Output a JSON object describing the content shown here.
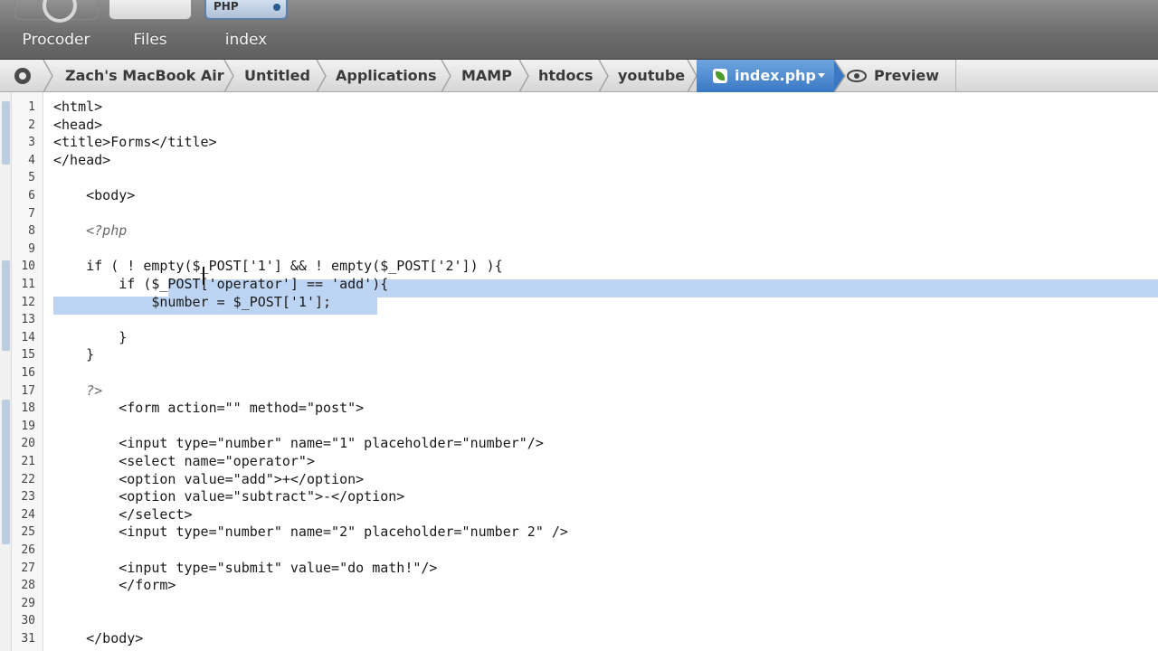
{
  "toolbar": {
    "tools": [
      {
        "label": "Procoder"
      },
      {
        "label": "Files"
      },
      {
        "label": "index",
        "badge": "PHP"
      }
    ]
  },
  "breadcrumb": {
    "items": [
      "Zach's MacBook Air",
      "Untitled",
      "Applications",
      "MAMP",
      "htdocs",
      "youtube"
    ],
    "active": "index.php",
    "preview": "Preview"
  },
  "editor": {
    "colors": {
      "tag": "#1a1a1a",
      "string": "#1a1a1a",
      "comment": "#6b6b6b",
      "selection": "#bdd4f2",
      "keyword_op": "#2f6fd0"
    },
    "lines": [
      {
        "n": "1",
        "text": "<html>"
      },
      {
        "n": "2",
        "text": "<head>"
      },
      {
        "n": "3",
        "text": "<title>Forms</title>"
      },
      {
        "n": "4",
        "text": "</head>"
      },
      {
        "n": "5",
        "text": ""
      },
      {
        "n": "6",
        "text": "    <body>"
      },
      {
        "n": "7",
        "text": ""
      },
      {
        "n": "8",
        "text": "    <?php"
      },
      {
        "n": "9",
        "text": ""
      },
      {
        "n": "10",
        "text": "    if ( ! empty($_POST['1'] && ! empty($_POST['2']) ){"
      },
      {
        "n": "11",
        "text": "        if ($_POST['operator'] == 'add'){"
      },
      {
        "n": "12",
        "text": "            $number = $_POST['1'];"
      },
      {
        "n": "13",
        "text": ""
      },
      {
        "n": "14",
        "text": "        }"
      },
      {
        "n": "15",
        "text": "    }"
      },
      {
        "n": "16",
        "text": ""
      },
      {
        "n": "17",
        "text": "    ?>"
      },
      {
        "n": "18",
        "text": "        <form action=\"\" method=\"post\">"
      },
      {
        "n": "19",
        "text": ""
      },
      {
        "n": "20",
        "text": "        <input type=\"number\" name=\"1\" placeholder=\"number\"/>"
      },
      {
        "n": "21",
        "text": "        <select name=\"operator\">"
      },
      {
        "n": "22",
        "text": "        <option value=\"add\">+</option>"
      },
      {
        "n": "23",
        "text": "        <option value=\"subtract\">-</option>"
      },
      {
        "n": "24",
        "text": "        </select>"
      },
      {
        "n": "25",
        "text": "        <input type=\"number\" name=\"2\" placeholder=\"number 2\" />"
      },
      {
        "n": "26",
        "text": ""
      },
      {
        "n": "27",
        "text": "        <input type=\"submit\" value=\"do math!\"/>"
      },
      {
        "n": "28",
        "text": "        </form>"
      },
      {
        "n": "29",
        "text": ""
      },
      {
        "n": "30",
        "text": ""
      },
      {
        "n": "31",
        "text": "    </body>"
      }
    ]
  }
}
